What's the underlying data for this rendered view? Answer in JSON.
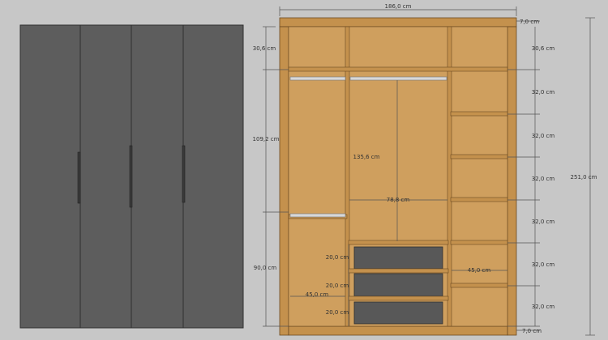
{
  "colors": {
    "background": "#c7c7c7",
    "door": "#5d5d5d",
    "door_edge": "#2f2f2f",
    "wood": "#c4914d",
    "wood_light": "#cf9f5e",
    "wood_edge": "#6b4a22",
    "drawer_front": "#585858",
    "dimension_line": "#555555",
    "dimension_text": "#333333"
  },
  "dimensions": {
    "total_width": "186,0 cm",
    "total_height": "251,0 cm",
    "plinth_top": "7,0 cm",
    "plinth_bottom": "7,0 cm",
    "left_top_compartment": "30,6 cm",
    "left_upper_hanging": "109,2 cm",
    "left_lower_hanging": "90,0 cm",
    "right_top_compartment": "30,6 cm",
    "right_shelves": [
      "32,0 cm",
      "32,0 cm",
      "32,0 cm",
      "32,0 cm",
      "32,0 cm",
      "32,0 cm"
    ],
    "middle_hanging_height": "135,6 cm",
    "middle_width": "78,8 cm",
    "drawers": [
      "20,0 cm",
      "20,0 cm",
      "20,0 cm"
    ],
    "left_section_width": "45,0 cm",
    "right_section_width": "45,0 cm"
  }
}
